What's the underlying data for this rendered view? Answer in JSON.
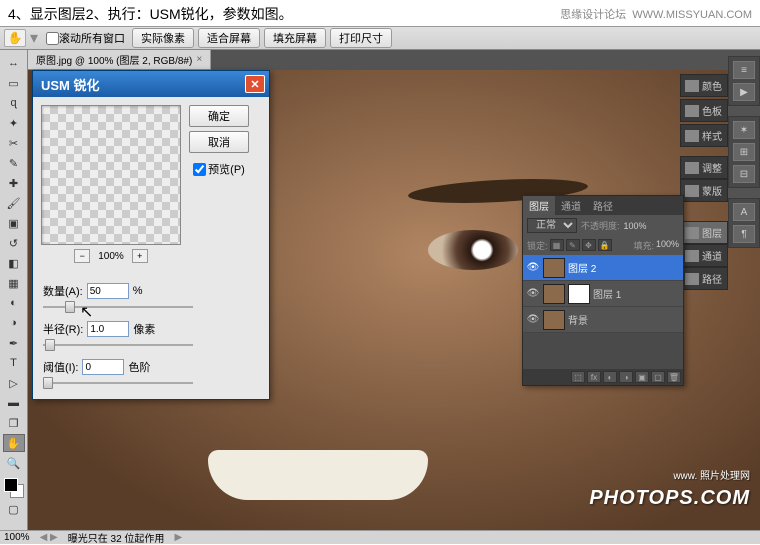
{
  "header": {
    "instruction": "4、显示图层2、执行：USM锐化，参数如图。",
    "forum": "思缘设计论坛",
    "url": "WWW.MISSYUAN.COM"
  },
  "options_bar": {
    "scroll_all": "滚动所有窗口",
    "actual_pixels": "实际像素",
    "fit_screen": "适合屏幕",
    "fill_screen": "填充屏幕",
    "print_size": "打印尺寸"
  },
  "document": {
    "tab_label": "原图.jpg @ 100% (图层 2, RGB/8#)"
  },
  "dialog": {
    "title": "USM 锐化",
    "ok": "确定",
    "cancel": "取消",
    "preview": "预览(P)",
    "zoom_value": "100%",
    "amount_label": "数量(A):",
    "amount_value": "50",
    "amount_unit": "%",
    "radius_label": "半径(R):",
    "radius_value": "1.0",
    "radius_unit": "像素",
    "threshold_label": "阈值(I):",
    "threshold_value": "0",
    "threshold_unit": "色阶"
  },
  "side_panels": {
    "color": "颜色",
    "swatches": "色板",
    "styles": "样式",
    "adjustments": "调整",
    "masks": "蒙版",
    "layers": "图层",
    "channels": "通道",
    "paths": "路径"
  },
  "layers_panel": {
    "tabs": [
      "图层",
      "通道",
      "路径"
    ],
    "blend_mode": "正常",
    "opacity_label": "不透明度:",
    "opacity_value": "100%",
    "lock_label": "锁定:",
    "fill_label": "填充:",
    "fill_value": "100%",
    "layers": [
      {
        "name": "图层 2"
      },
      {
        "name": "图层 1"
      },
      {
        "name": "背景"
      }
    ]
  },
  "status_bar": {
    "zoom": "100%",
    "info": "曝光只在 32 位起作用"
  },
  "watermark": {
    "small": "www.    照片处理网",
    "large": "PHOTOPS.COM"
  }
}
